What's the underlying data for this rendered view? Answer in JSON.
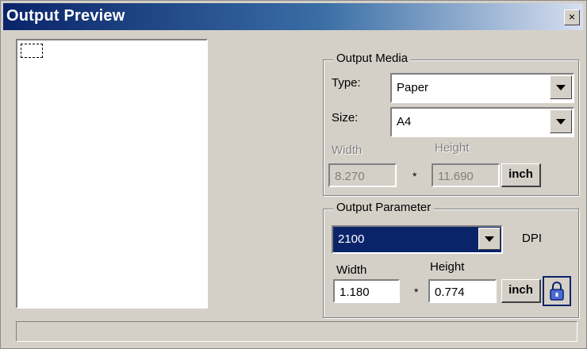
{
  "window": {
    "title": "Output Preview",
    "close_glyph": "×"
  },
  "media": {
    "legend": "Output Media",
    "type_label": "Type:",
    "type_value": "Paper",
    "size_label": "Size:",
    "size_value": "A4",
    "width_label": "Width",
    "height_label": "Height",
    "width_value": "8.270",
    "height_value": "11.690",
    "times": "*",
    "unit_button": "inch"
  },
  "param": {
    "legend": "Output Parameter",
    "dpi_value": "2100",
    "dpi_label": "DPI",
    "width_label": "Width",
    "height_label": "Height",
    "width_value": "1.180",
    "height_value": "0.774",
    "times": "*",
    "unit_button": "inch",
    "lock_icon": "lock-icon"
  },
  "status": {
    "text": ""
  }
}
